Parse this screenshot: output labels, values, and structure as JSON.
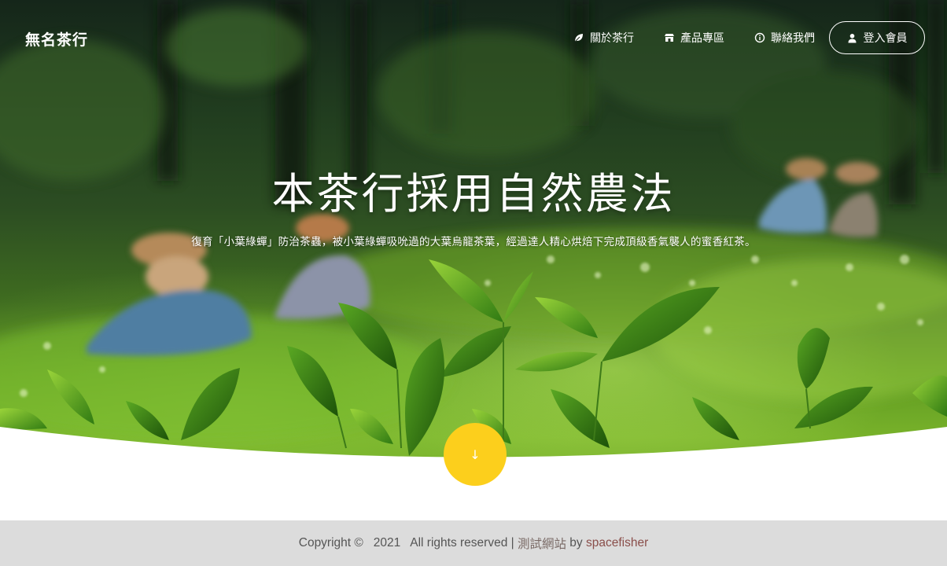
{
  "brand": {
    "name": "無名茶行"
  },
  "nav": {
    "items": [
      {
        "label": "關於茶行",
        "icon": "leaf-icon"
      },
      {
        "label": "產品專區",
        "icon": "store-icon"
      },
      {
        "label": "聯絡我們",
        "icon": "info-circle-icon"
      }
    ],
    "login": {
      "label": "登入會員",
      "icon": "user-icon"
    }
  },
  "hero": {
    "title": "本茶行採用自然農法",
    "subtitle": "復育「小葉綠蟬」防治茶蟲，被小葉綠蟬吸吮過的大葉烏龍茶葉，經過達人精心烘焙下完成頂級香氣襲人的蜜香紅茶。",
    "scroll_icon": "↓"
  },
  "footer": {
    "copyright": "Copyright ©   2021   All rights reserved | ",
    "site_label": "測試網站",
    "by": " by ",
    "author": "spacefisher"
  },
  "colors": {
    "accent": "#fccf1c",
    "footer_bg": "#dcdcdc",
    "footer_text": "#555555",
    "author_link": "#8a4e4a"
  }
}
